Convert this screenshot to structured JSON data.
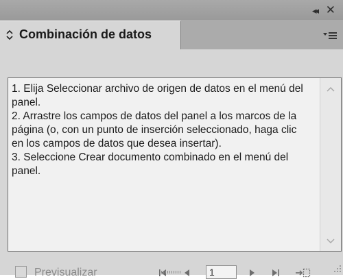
{
  "panel": {
    "title": "Combinación de datos",
    "instructions": "1. Elija Seleccionar archivo de origen de datos en el menú del panel.\n2. Arrastre los campos de datos del panel a los marcos de la página (o, con un punto de inserción seleccionado, haga clic en los campos de datos que desea insertar).\n3. Seleccione Crear documento combinado en el menú del panel.",
    "preview_label": "Previsualizar",
    "preview_checked": false,
    "page_number": "1"
  },
  "icons": {
    "collapse": "double-chevron-left-icon",
    "close": "close-icon",
    "flyout_menu": "panel-menu-icon",
    "tab_toggle": "up-down-arrows-icon",
    "first": "first-record-icon",
    "prev": "previous-record-icon",
    "next": "next-record-icon",
    "last": "last-record-icon",
    "create_merged": "create-merged-document-icon"
  },
  "colors": {
    "panel_bg": "#d6d6d6",
    "titlebar": "#a0a0a0",
    "textbox_bg": "#f1f1f1",
    "disabled_text": "#8a8a8a"
  }
}
